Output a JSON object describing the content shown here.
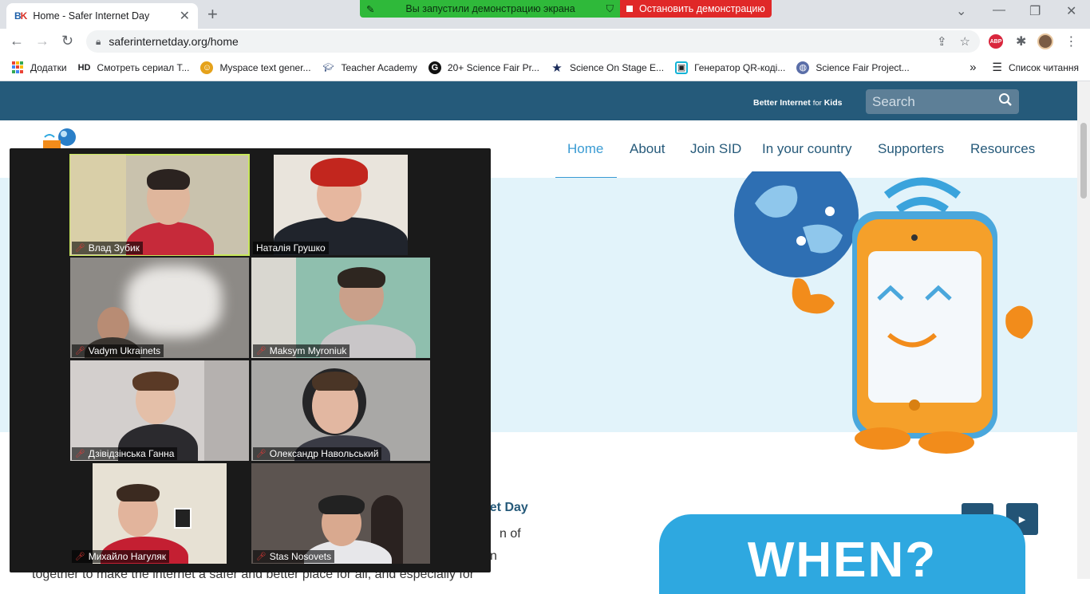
{
  "browser": {
    "tab_favicon_a": "B",
    "tab_favicon_b": "K",
    "tab_title": "Home - Safer Internet Day",
    "url": "saferinternetday.org/home"
  },
  "screen_share": {
    "status": "Вы запустили демонстрацию экрана",
    "stop_label": "Остановить демонстрацию"
  },
  "bookmarks": {
    "items": [
      {
        "label": "Додатки",
        "icon": "apps-grid-icon"
      },
      {
        "label": "Смотреть сериал Т...",
        "icon": "hd-icon"
      },
      {
        "label": "Myspace text gener...",
        "icon": "myspace-icon"
      },
      {
        "label": "Teacher Academy",
        "icon": "graduation-cap-icon"
      },
      {
        "label": "20+ Science Fair Pr...",
        "icon": "g-icon"
      },
      {
        "label": "Science On Stage E...",
        "icon": "star-icon"
      },
      {
        "label": "Генератор QR-коді...",
        "icon": "qr-icon"
      },
      {
        "label": "Science Fair Project...",
        "icon": "globe-icon"
      }
    ],
    "more": "»",
    "reading_list": "Список читання"
  },
  "site": {
    "brand": "Better Internet",
    "brand_for": "for",
    "brand_kids": "Kids",
    "search_placeholder": "Search",
    "nav": [
      "Home",
      "About",
      "Join SID",
      "In your country",
      "Supporters",
      "Resources"
    ],
    "content_title": "net Day",
    "content_line1": "n of",
    "content_line2": "n",
    "content_line3": "together to make the internet a safer and better place for all, and especially for",
    "when": "WHEN?"
  },
  "meeting": {
    "participants": [
      {
        "name": "Влад Зубик",
        "active": true
      },
      {
        "name": "Наталія Грушко",
        "active": false
      },
      {
        "name": "Vadym Ukrainets",
        "active": false
      },
      {
        "name": "Maksym Myroniuk",
        "active": false
      },
      {
        "name": "Дзівідзінська Ганна",
        "active": false
      },
      {
        "name": "Олександр Навольський",
        "active": false
      },
      {
        "name": "Михайло Нагуляк",
        "active": false
      },
      {
        "name": "Stas Nosovets",
        "active": false
      }
    ]
  },
  "colors": {
    "site_header": "#255a7a",
    "nav_active": "#3a9bd3",
    "hero_bg": "#e2f3fa",
    "when_box": "#2ea8e0",
    "share_green": "#2fb93a",
    "share_red": "#e02828"
  }
}
